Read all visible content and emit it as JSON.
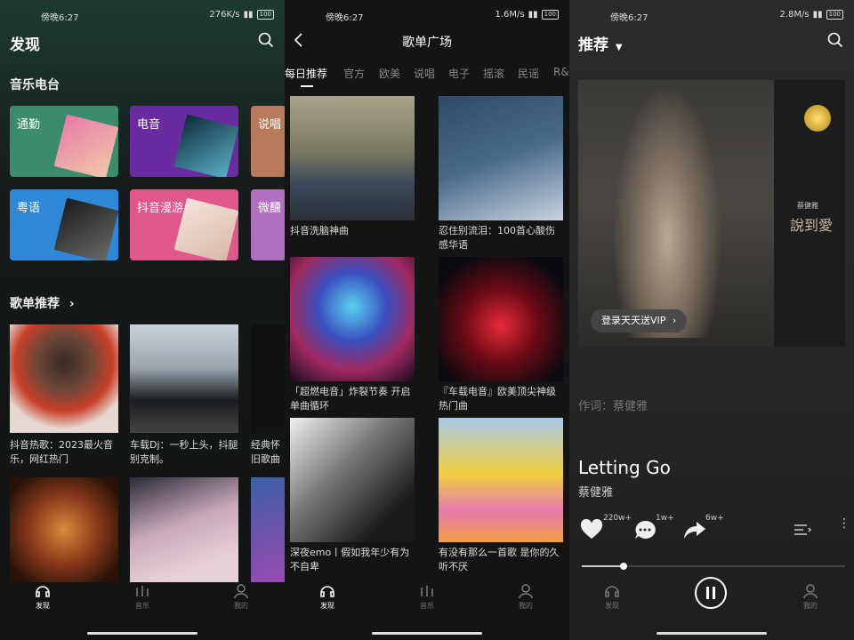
{
  "status_bars": [
    {
      "time": "傍晚6:27",
      "speed": "276K/s",
      "battery": "100"
    },
    {
      "time": "傍晚6:27",
      "speed": "1.6M/s",
      "battery": "100"
    },
    {
      "time": "傍晚6:27",
      "speed": "2.8M/s",
      "battery": "100"
    }
  ],
  "discover": {
    "title": "发现",
    "radio_section": "音乐电台",
    "radio_cards": [
      {
        "label": "通勤",
        "color": "#3a8c6c"
      },
      {
        "label": "电音",
        "color": "#6a2aa0"
      },
      {
        "label": "说唱",
        "color": "#b87a5a"
      },
      {
        "label": "粤语",
        "color": "#2e88d8"
      },
      {
        "label": "抖音漫游",
        "color": "#e0578a"
      },
      {
        "label": "微醺",
        "color": "#b070c0"
      }
    ],
    "playlist_section": "歌单推荐",
    "playlists": [
      {
        "caption": "抖音热歌：2023最火音乐，网红热门"
      },
      {
        "caption": "车载Dj：一秒上头，抖腿别克制。"
      },
      {
        "caption": "经典怀旧歌曲"
      }
    ]
  },
  "playlist_square": {
    "title": "歌单广场",
    "tabs": [
      "每日推荐",
      "官方",
      "欧美",
      "说唱",
      "电子",
      "摇滚",
      "民谣",
      "R&"
    ],
    "active_tab": 0,
    "items": [
      {
        "caption": "抖音洗脑神曲"
      },
      {
        "caption": "忍住别流泪：100首心酸伤感华语"
      },
      {
        "caption": "「超燃电音」炸裂节奏 开启单曲循环"
      },
      {
        "caption": "『车载电音』欧美顶尖神级热门曲"
      },
      {
        "caption": "深夜emo丨假如我年少有为不自卑"
      },
      {
        "caption": "有没有那么一首歌 是你的久听不厌"
      }
    ]
  },
  "player": {
    "title": "推荐",
    "album_art_text": "說到愛",
    "album_artist_text": "蔡健雅",
    "vip_pill": "登录天天送VIP",
    "lyric": "作词：蔡健雅",
    "song_title": "Letting Go",
    "artist": "蔡健雅",
    "like_count": "220w+",
    "comment_count": "1w+",
    "share_count": "6w+",
    "progress": 0.16
  },
  "tabbar": {
    "discover": "发现",
    "music": "音乐",
    "me": "我的"
  }
}
